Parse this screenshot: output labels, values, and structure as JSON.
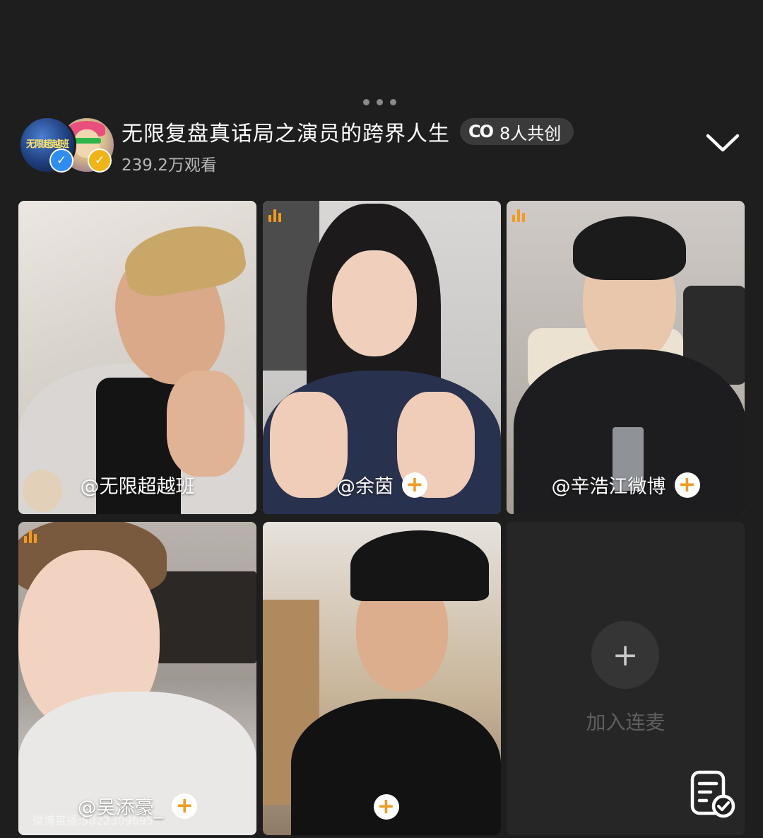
{
  "header": {
    "live_title": "无限复盘真话局之演员的跨界人生",
    "co_badge_icon": "CO",
    "co_badge_label": "8人共创",
    "viewers": "239.2万观看",
    "avatar_logo_text": "无限超越班"
  },
  "tiles": [
    {
      "name": "@无限超越班",
      "has_follow": false,
      "speaking": false
    },
    {
      "name": "@余茵",
      "has_follow": true,
      "speaking": true
    },
    {
      "name": "@辛浩江微博",
      "has_follow": true,
      "speaking": true
    },
    {
      "name": "@吴添豪_",
      "has_follow": true,
      "speaking": true
    },
    {
      "name": "",
      "has_follow": true,
      "speaking": false
    }
  ],
  "join_tile": {
    "icon": "+",
    "label": "加入连麦"
  },
  "follow_glyph": "+",
  "watermark": "微博直播:5822309695",
  "colors": {
    "accent": "#f29a1f",
    "background": "#1e1e1e",
    "verified_blue": "#2f8df0",
    "verified_gold": "#f1b417"
  },
  "icons": [
    "chevron-down-icon",
    "signal-bars-icon",
    "document-check-icon",
    "verified-badge-icon"
  ]
}
